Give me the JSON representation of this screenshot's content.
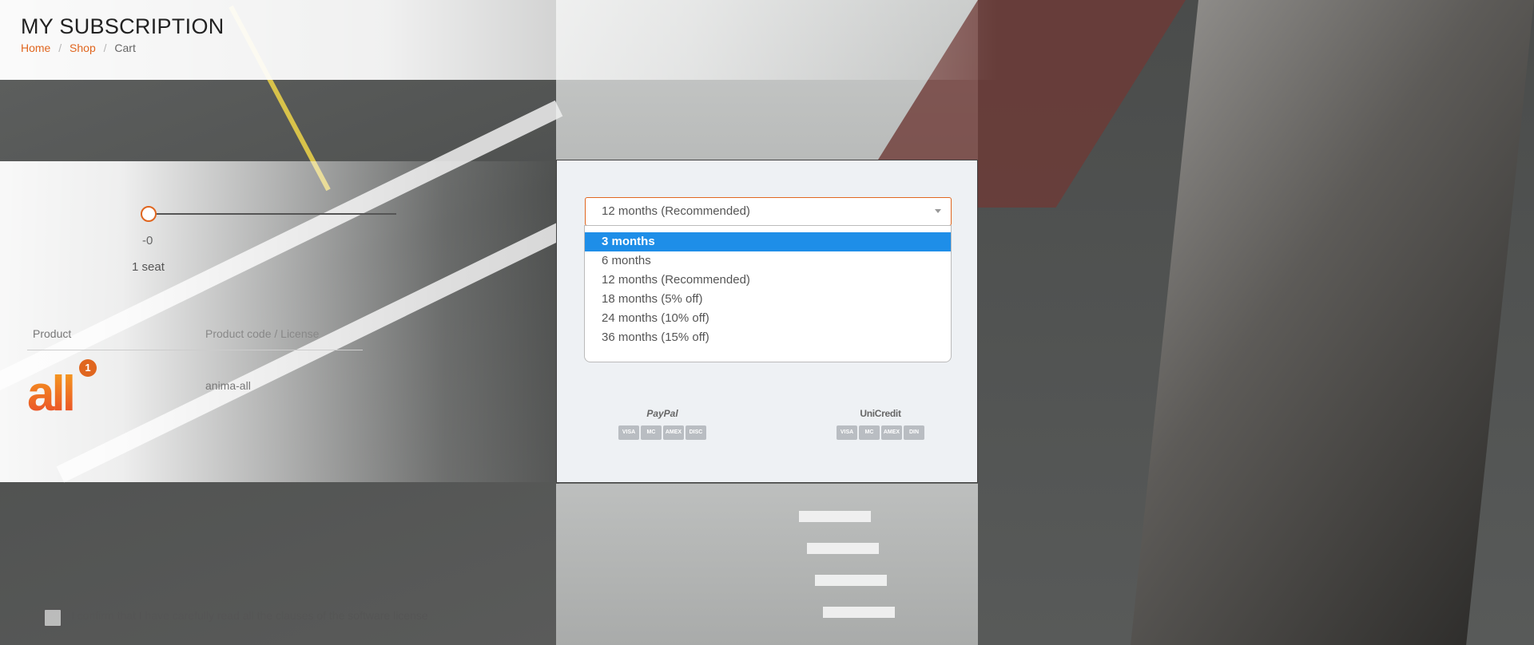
{
  "header": {
    "title": "MY SUBSCRIPTION",
    "breadcrumb": [
      "Home",
      "Shop",
      "Cart"
    ],
    "separator": "/"
  },
  "seats": {
    "slider_value_label": "-0",
    "seat_label": "1 seat"
  },
  "product_table": {
    "columns": [
      "Product",
      "Product code / License"
    ],
    "rows": [
      {
        "logo_text": "all",
        "badge": "1",
        "code": "anima-all"
      }
    ]
  },
  "confirm": {
    "text": "I confirm that I have carefully read all the clauses of the software license"
  },
  "duration_select": {
    "value": "12 months (Recommended)",
    "options": [
      "3 months",
      "6 months",
      "12 months (Recommended)",
      "18 months (5% off)",
      "24 months (10% off)",
      "36 months (15% off)"
    ],
    "highlighted_option": "3 months"
  },
  "payment": {
    "paypal_label": "PayPal",
    "unicredit_label": "UniCredit",
    "paypal_cards": [
      "VISA",
      "MC",
      "AMEX",
      "DISC"
    ],
    "unicredit_cards": [
      "VISA",
      "MC",
      "AMEX",
      "DIN"
    ]
  },
  "colors": {
    "accent": "#e0661f",
    "select_highlight": "#1e8ee8"
  }
}
